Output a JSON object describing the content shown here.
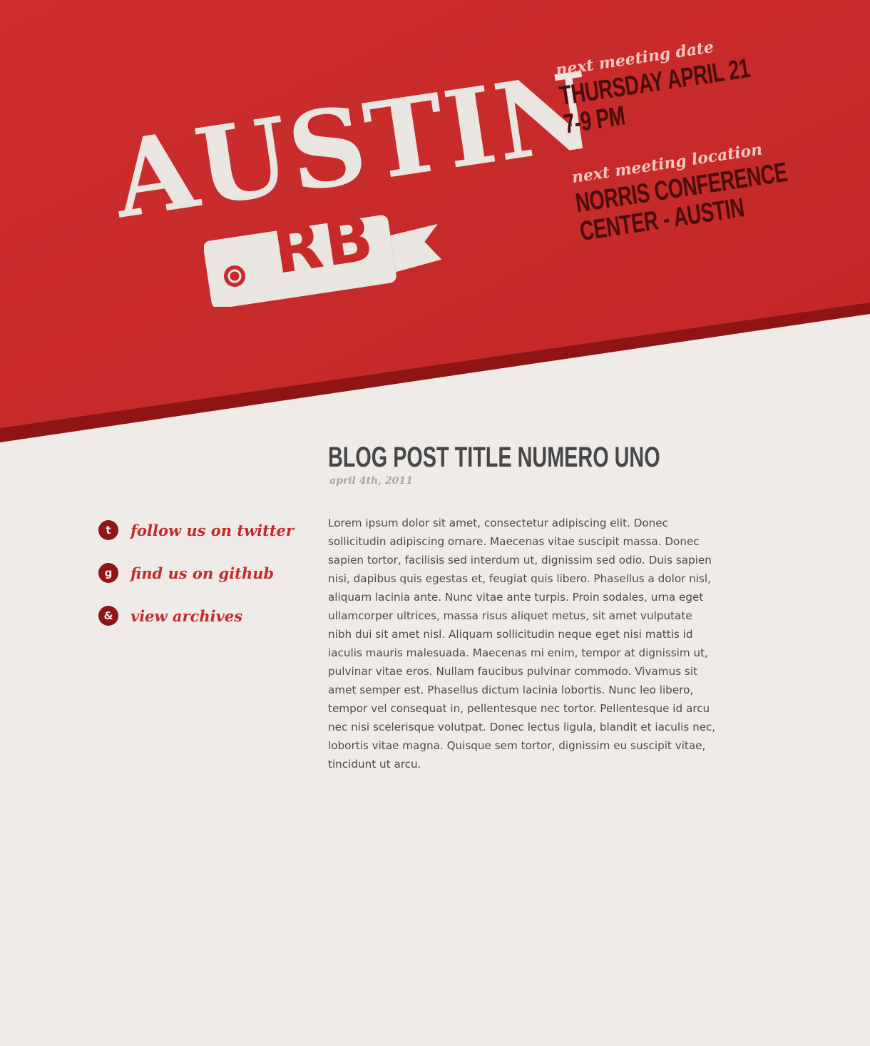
{
  "logo": {
    "city": "AUSTIN",
    "group": "RB"
  },
  "meeting": {
    "date_label": "next meeting date",
    "date_line1": "THURSDAY APRIL 21",
    "date_line2": "7-9 PM",
    "location_label": "next meeting location",
    "location_line1": "NORRIS CONFERENCE",
    "location_line2": "CENTER - AUSTIN"
  },
  "sidebar": {
    "links": [
      {
        "icon": "twitter-icon",
        "glyph": "t",
        "label": "follow us on twitter"
      },
      {
        "icon": "github-icon",
        "glyph": "g",
        "label": "find us on github"
      },
      {
        "icon": "ruby-emblem-icon",
        "glyph": "&",
        "label": "view archives"
      }
    ]
  },
  "post": {
    "title": "BLOG POST TITLE NUMERO UNO",
    "date": "april 4th, 2011",
    "body": "Lorem ipsum dolor sit amet, consectetur adipiscing elit. Donec sollicitu­din adipiscing ornare. Maecenas vitae suscipit massa. Donec sapien tortor, facilisis sed interdum ut, dignissim sed odio. Duis sapien nisi, dapibus quis egestas et, feugiat quis libero. Phasellus a dolor nisl, aliquam lacinia ante. Nunc vitae ante turpis. Proin sodales, urna eget ullamcorper ultrices, massa risus aliquet metus, sit amet vulputate nibh dui sit amet nisl. Aliquam sollicitudin neque eget nisi mattis id iaculis mauris malesuada. Maecenas mi enim, tempor at dignissim ut, pulvinar vitae eros. Nullam faucibus pulvinar commodo. Vivamus sit amet semper est. Phasellus dictum lacinia lobortis. Nunc leo libero, tempor vel conse­quat in, pellentesque nec tortor. Pellentesque id arcu nec nisi scelerisque volutpat. Donec lectus ligula, blandit et iaculis nec, lobortis vitae magna. Quisque sem tortor, dignissim eu suscipit vitae, tincidunt ut arcu."
  },
  "colors": {
    "header_red": "#c92c2b",
    "header_edge": "#8f1414",
    "page_bg": "#efebe8",
    "meeting_dark": "#4a0c0c",
    "meeting_script": "#f3c7c3",
    "link_red": "#c42a2a",
    "icon_bg": "#8e1616",
    "title_gray": "#474747",
    "text_gray": "#4b4b4b"
  }
}
